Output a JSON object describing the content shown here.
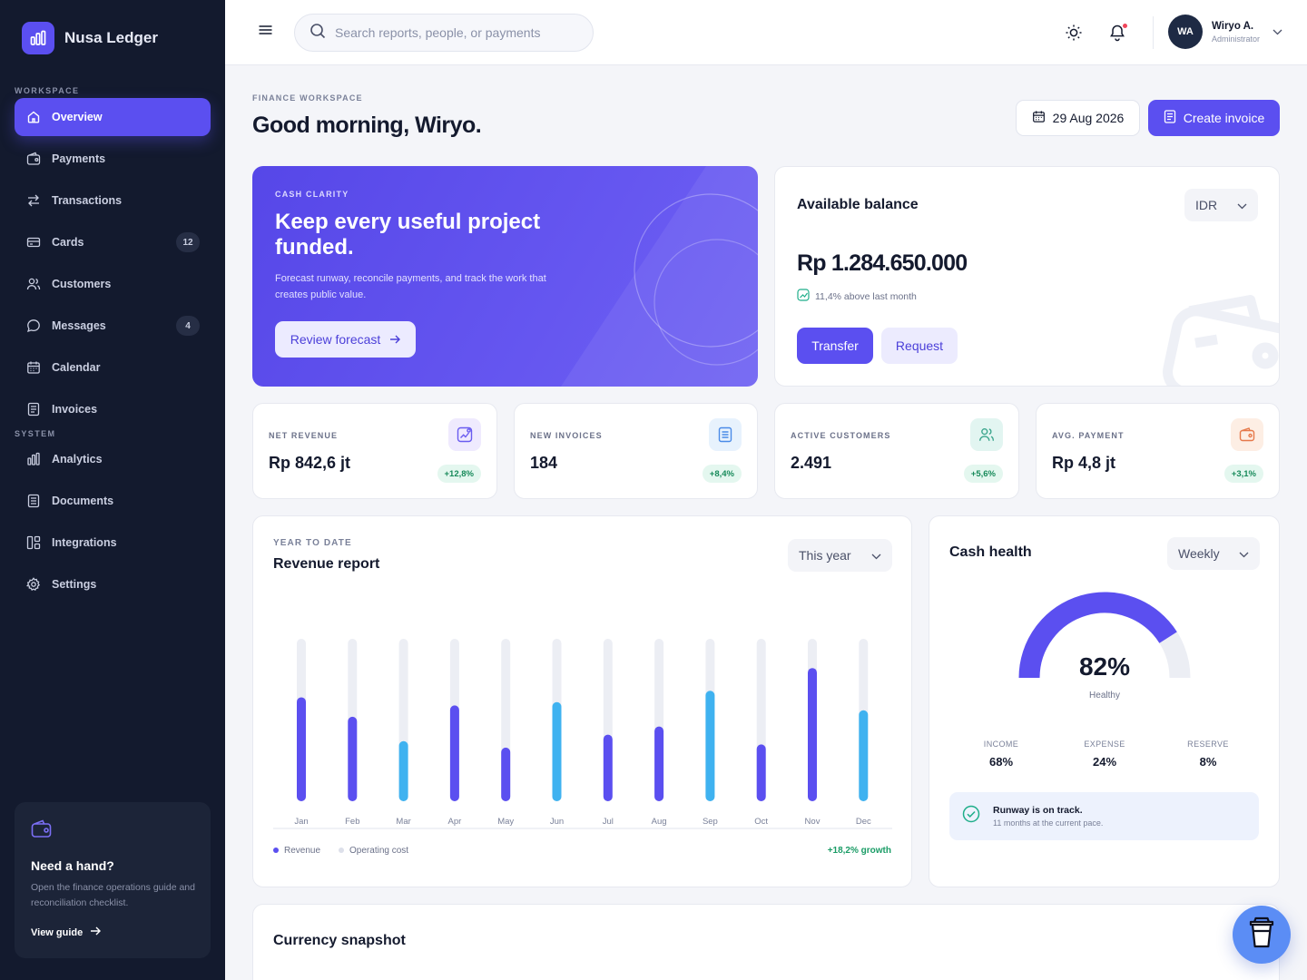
{
  "brand": {
    "name": "Nusa Ledger"
  },
  "sidebar": {
    "workspace_label": "WORKSPACE",
    "system_label": "SYSTEM",
    "items": [
      {
        "label": "Overview",
        "icon": "home-icon",
        "active": true
      },
      {
        "label": "Payments",
        "icon": "wallet-icon"
      },
      {
        "label": "Transactions",
        "icon": "arrows-icon"
      },
      {
        "label": "Cards",
        "icon": "card-icon",
        "badge": "12"
      },
      {
        "label": "Customers",
        "icon": "users-icon"
      },
      {
        "label": "Messages",
        "icon": "chat-icon",
        "badge": "4"
      },
      {
        "label": "Calendar",
        "icon": "calendar-icon"
      },
      {
        "label": "Invoices",
        "icon": "receipt-icon"
      }
    ],
    "system_items": [
      {
        "label": "Analytics",
        "icon": "bar-chart-icon"
      },
      {
        "label": "Documents",
        "icon": "document-icon"
      },
      {
        "label": "Integrations",
        "icon": "grid-icon"
      },
      {
        "label": "Settings",
        "icon": "gear-icon"
      }
    ],
    "help": {
      "title": "Need a hand?",
      "text": "Open the finance operations guide and reconciliation checklist.",
      "link": "View guide"
    }
  },
  "topbar": {
    "search_placeholder": "Search reports, people, or payments",
    "user": {
      "initials": "WA",
      "name": "Wiryo A.",
      "role": "Administrator"
    }
  },
  "header": {
    "eyebrow": "FINANCE WORKSPACE",
    "title": "Good morning, Wiryo.",
    "date": "29 Aug 2026",
    "create_label": "Create invoice"
  },
  "hero": {
    "eyebrow": "CASH CLARITY",
    "title": "Keep every useful project funded.",
    "text": "Forecast runway, reconcile payments, and track the work that creates public value.",
    "button": "Review forecast"
  },
  "balance": {
    "title": "Available balance",
    "currency": "IDR",
    "amount": "Rp 1.284.650.000",
    "change": "11,4% above last month",
    "transfer": "Transfer",
    "request": "Request"
  },
  "stats": [
    {
      "label": "NET REVENUE",
      "value": "Rp 842,6 jt",
      "change": "+12,8%",
      "icon": "chart-up-icon",
      "tint": "#efeafe",
      "color": "#6a5cf0"
    },
    {
      "label": "NEW INVOICES",
      "value": "184",
      "change": "+8,4%",
      "icon": "invoice-icon",
      "tint": "#e7f2fd",
      "color": "#4a8be8"
    },
    {
      "label": "ACTIVE CUSTOMERS",
      "value": "2.491",
      "change": "+5,6%",
      "icon": "users-icon",
      "tint": "#e2f5f1",
      "color": "#3aa58c"
    },
    {
      "label": "AVG. PAYMENT",
      "value": "Rp 4,8 jt",
      "change": "+3,1%",
      "icon": "wallet-icon",
      "tint": "#fdeee4",
      "color": "#e6794a"
    }
  ],
  "revenue": {
    "eyebrow": "YEAR TO DATE",
    "title": "Revenue report",
    "period": "This year",
    "growth": "+18,2% growth"
  },
  "chart_data": {
    "type": "bar",
    "categories": [
      "Jan",
      "Feb",
      "Mar",
      "Apr",
      "May",
      "Jun",
      "Jul",
      "Aug",
      "Sep",
      "Oct",
      "Nov",
      "Dec"
    ],
    "series": [
      {
        "name": "Revenue",
        "values": [
          64,
          52,
          37,
          59,
          33,
          61,
          41,
          46,
          68,
          35,
          82,
          56
        ]
      },
      {
        "name": "Operating cost",
        "values": [
          100,
          100,
          100,
          100,
          100,
          100,
          100,
          100,
          100,
          100,
          100,
          100
        ]
      }
    ],
    "bar_colors": [
      "#5b4ff0",
      "#5b4ff0",
      "#3fb2f0",
      "#5b4ff0",
      "#5b4ff0",
      "#3fb2f0",
      "#5b4ff0",
      "#5b4ff0",
      "#3fb2f0",
      "#5b4ff0",
      "#5b4ff0",
      "#3fb2f0"
    ],
    "track_color": "#eceef4",
    "ylim": [
      0,
      100
    ],
    "grid": false,
    "legend": "bottom-left"
  },
  "cash_health": {
    "title": "Cash health",
    "period": "Weekly",
    "score": 82,
    "score_label": "82%",
    "status": "Healthy",
    "gauge_color": "#5b4ff0",
    "metrics": [
      {
        "label": "INCOME",
        "value": "68%"
      },
      {
        "label": "EXPENSE",
        "value": "24%"
      },
      {
        "label": "RESERVE",
        "value": "8%"
      }
    ],
    "runway_title": "Runway is on track.",
    "runway_sub": "11 months at the current pace."
  },
  "currency": {
    "title": "Currency snapshot"
  },
  "colors": {
    "accent": "#5b4ff0",
    "sidebar": "#131a2e",
    "positive": "#1a9c66"
  }
}
